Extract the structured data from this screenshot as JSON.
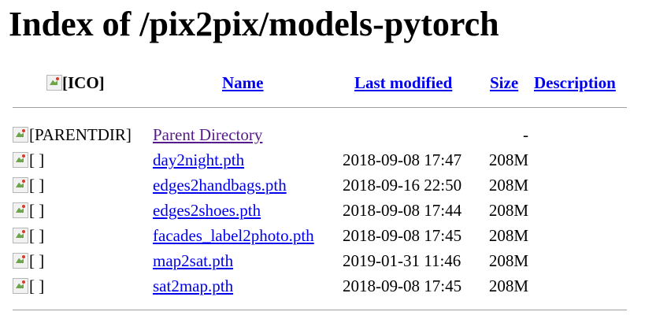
{
  "page": {
    "title": "Index of /pix2pix/models-pytorch"
  },
  "header": {
    "icon_alt": "[ICO]",
    "name": "Name",
    "last_modified": "Last modified",
    "size": "Size",
    "description": "Description"
  },
  "parent": {
    "icon_alt": "[PARENTDIR]",
    "name": "Parent Directory",
    "size": "-"
  },
  "files": [
    {
      "icon_alt": "[ ]",
      "name": "day2night.pth",
      "modified": "2018-09-08 17:47",
      "size": "208M"
    },
    {
      "icon_alt": "[ ]",
      "name": "edges2handbags.pth",
      "modified": "2018-09-16 22:50",
      "size": "208M"
    },
    {
      "icon_alt": "[ ]",
      "name": "edges2shoes.pth",
      "modified": "2018-09-08 17:44",
      "size": "208M"
    },
    {
      "icon_alt": "[ ]",
      "name": "facades_label2photo.pth",
      "modified": "2018-09-08 17:45",
      "size": "208M"
    },
    {
      "icon_alt": "[ ]",
      "name": "map2sat.pth",
      "modified": "2019-01-31 11:46",
      "size": "208M"
    },
    {
      "icon_alt": "[ ]",
      "name": "sat2map.pth",
      "modified": "2018-09-08 17:45",
      "size": "208M"
    }
  ]
}
